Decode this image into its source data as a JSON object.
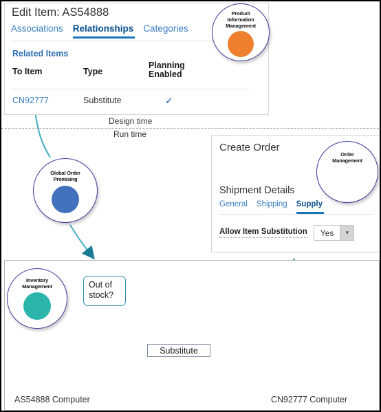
{
  "design_panel": {
    "title": "Edit Item: AS54888",
    "tabs": [
      {
        "label": "Associations",
        "active": false
      },
      {
        "label": "Relationships",
        "active": true
      },
      {
        "label": "Categories",
        "active": false
      }
    ],
    "section_title": "Related Items",
    "columns": [
      "To Item",
      "Type",
      "Planning Enabled"
    ],
    "column_planning_line1": "Planning",
    "column_planning_line2": "Enabled",
    "rows": [
      {
        "to_item": "CN92777",
        "type": "Substitute",
        "planning_enabled": "✓"
      }
    ]
  },
  "badges": {
    "pim": {
      "line1": "Product",
      "line2": "Information",
      "line3": "Management",
      "icon": "barcode-icon",
      "disc_color": "#ee7f2d"
    },
    "gop": {
      "line1": "Global Order",
      "line2": "Promising",
      "icon": "calendar-icon",
      "disc_color": "#4371bd"
    },
    "om": {
      "line1": "Order",
      "line2": "Management",
      "icon": "supply-chain-icon",
      "disc_color": "#3a6fc4"
    },
    "inventory": {
      "line1": "Inventory",
      "line2": "Management",
      "icon": "forklift-icon",
      "disc_color": "#2cb5ab"
    }
  },
  "divider": {
    "design_label": "Design time",
    "run_label": "Run time"
  },
  "order_panel": {
    "title": "Create Order",
    "section_title": "Shipment Details",
    "tabs": [
      {
        "label": "General",
        "active": false
      },
      {
        "label": "Shipping",
        "active": false
      },
      {
        "label": "Supply",
        "active": true
      }
    ],
    "field_label": "Allow Item Substitution",
    "field_value": "Yes",
    "dropdown_icon": "chevron-down-icon"
  },
  "runtime": {
    "callout_line1": "Out of",
    "callout_line2": "stock?",
    "arrow_label": "Substitute",
    "left_item_label": "AS54888 Computer",
    "right_item_label": "CN92777  Computer"
  },
  "colors": {
    "link_blue": "#3a7fc1",
    "active_blue": "#0a4f8f",
    "accent_underline": "#1576bc",
    "badge_ring": "#3b3f9e",
    "teal_connector": "#2d8fa8",
    "arrow_blue": "#3f7fbe",
    "orange_pallet": "#c8521a",
    "wood_pallet": "#e8c06a"
  }
}
